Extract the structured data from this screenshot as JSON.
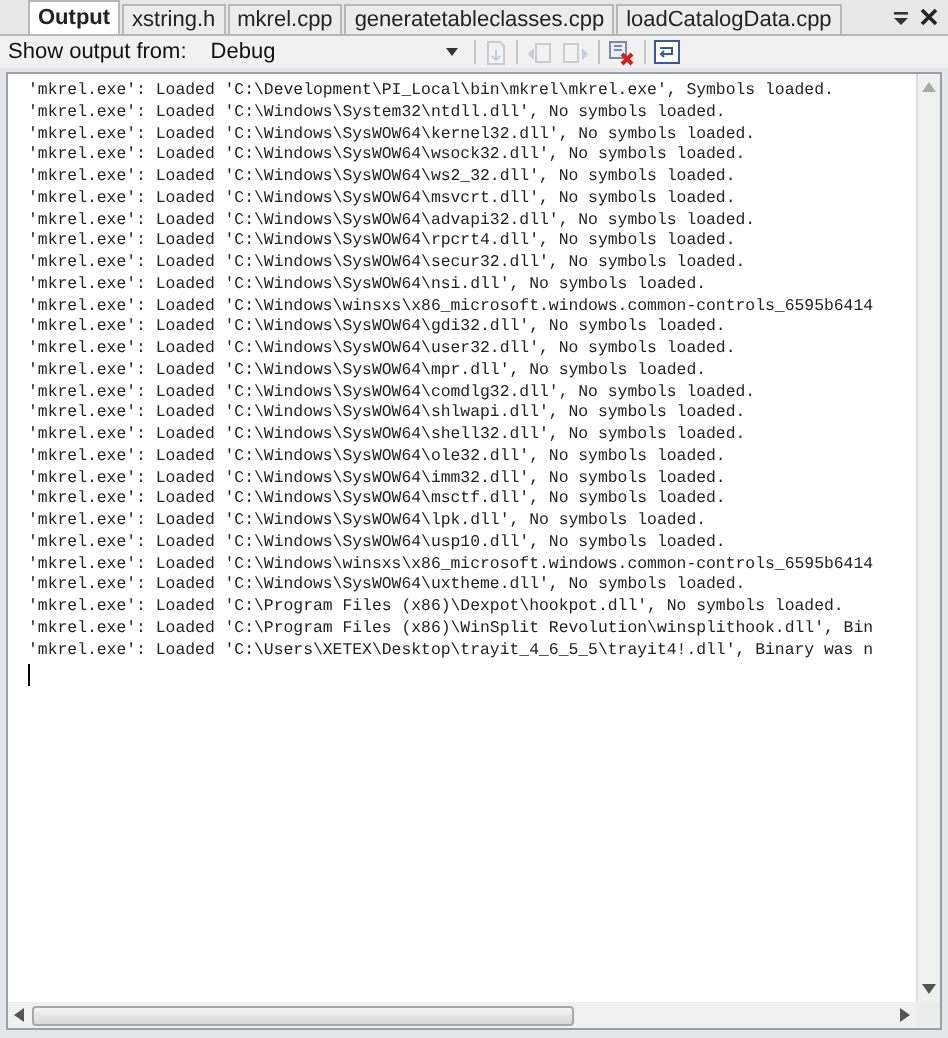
{
  "tabs": [
    {
      "label": "Output",
      "selected": true
    },
    {
      "label": "xstring.h",
      "selected": false
    },
    {
      "label": "mkrel.cpp",
      "selected": false
    },
    {
      "label": "generatetableclasses.cpp",
      "selected": false
    },
    {
      "label": "loadCatalogData.cpp",
      "selected": false
    }
  ],
  "toolbar": {
    "label": "Show output from:",
    "source": "Debug",
    "buttons": [
      {
        "kind": "goto",
        "disabled": true
      },
      {
        "kind": "prev",
        "disabled": true
      },
      {
        "kind": "next",
        "disabled": true
      },
      {
        "kind": "clear",
        "disabled": false
      },
      {
        "kind": "wrap",
        "disabled": false
      }
    ]
  },
  "output_lines": [
    "'mkrel.exe': Loaded 'C:\\Development\\PI_Local\\bin\\mkrel\\mkrel.exe', Symbols loaded.",
    "'mkrel.exe': Loaded 'C:\\Windows\\System32\\ntdll.dll', No symbols loaded.",
    "'mkrel.exe': Loaded 'C:\\Windows\\SysWOW64\\kernel32.dll', No symbols loaded.",
    "'mkrel.exe': Loaded 'C:\\Windows\\SysWOW64\\wsock32.dll', No symbols loaded.",
    "'mkrel.exe': Loaded 'C:\\Windows\\SysWOW64\\ws2_32.dll', No symbols loaded.",
    "'mkrel.exe': Loaded 'C:\\Windows\\SysWOW64\\msvcrt.dll', No symbols loaded.",
    "'mkrel.exe': Loaded 'C:\\Windows\\SysWOW64\\advapi32.dll', No symbols loaded.",
    "'mkrel.exe': Loaded 'C:\\Windows\\SysWOW64\\rpcrt4.dll', No symbols loaded.",
    "'mkrel.exe': Loaded 'C:\\Windows\\SysWOW64\\secur32.dll', No symbols loaded.",
    "'mkrel.exe': Loaded 'C:\\Windows\\SysWOW64\\nsi.dll', No symbols loaded.",
    "'mkrel.exe': Loaded 'C:\\Windows\\winsxs\\x86_microsoft.windows.common-controls_6595b6414",
    "'mkrel.exe': Loaded 'C:\\Windows\\SysWOW64\\gdi32.dll', No symbols loaded.",
    "'mkrel.exe': Loaded 'C:\\Windows\\SysWOW64\\user32.dll', No symbols loaded.",
    "'mkrel.exe': Loaded 'C:\\Windows\\SysWOW64\\mpr.dll', No symbols loaded.",
    "'mkrel.exe': Loaded 'C:\\Windows\\SysWOW64\\comdlg32.dll', No symbols loaded.",
    "'mkrel.exe': Loaded 'C:\\Windows\\SysWOW64\\shlwapi.dll', No symbols loaded.",
    "'mkrel.exe': Loaded 'C:\\Windows\\SysWOW64\\shell32.dll', No symbols loaded.",
    "'mkrel.exe': Loaded 'C:\\Windows\\SysWOW64\\ole32.dll', No symbols loaded.",
    "'mkrel.exe': Loaded 'C:\\Windows\\SysWOW64\\imm32.dll', No symbols loaded.",
    "'mkrel.exe': Loaded 'C:\\Windows\\SysWOW64\\msctf.dll', No symbols loaded.",
    "'mkrel.exe': Loaded 'C:\\Windows\\SysWOW64\\lpk.dll', No symbols loaded.",
    "'mkrel.exe': Loaded 'C:\\Windows\\SysWOW64\\usp10.dll', No symbols loaded.",
    "'mkrel.exe': Loaded 'C:\\Windows\\winsxs\\x86_microsoft.windows.common-controls_6595b6414",
    "'mkrel.exe': Loaded 'C:\\Windows\\SysWOW64\\uxtheme.dll', No symbols loaded.",
    "'mkrel.exe': Loaded 'C:\\Program Files (x86)\\Dexpot\\hookpot.dll', No symbols loaded.",
    "'mkrel.exe': Loaded 'C:\\Program Files (x86)\\WinSplit Revolution\\winsplithook.dll', Bin",
    "'mkrel.exe': Loaded 'C:\\Users\\XETEX\\Desktop\\trayit_4_6_5_5\\trayit4!.dll', Binary was n"
  ]
}
